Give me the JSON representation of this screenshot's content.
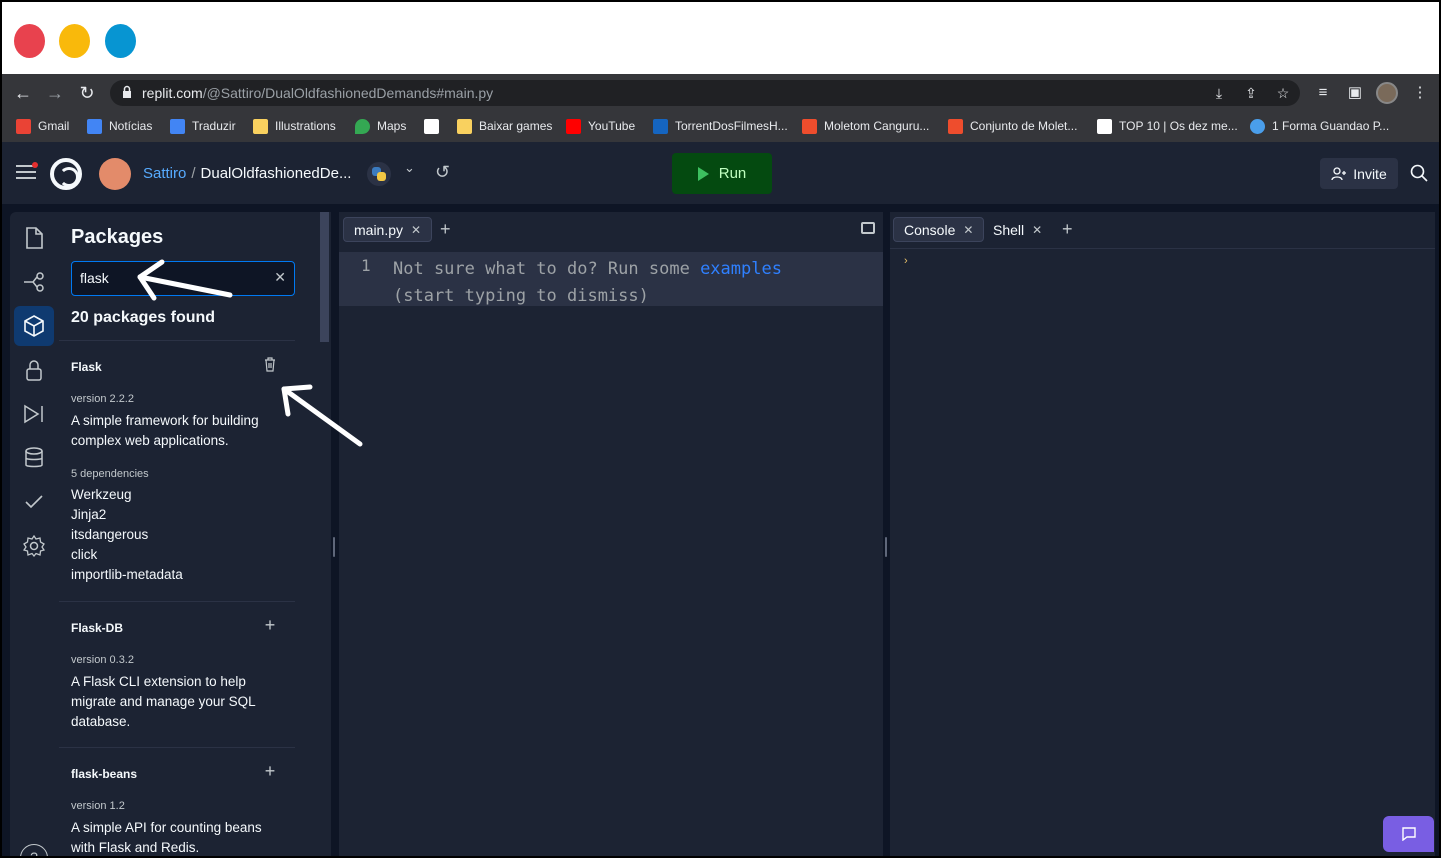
{
  "browser": {
    "url_host": "replit.com",
    "url_path": "/@Sattiro/DualOldfashionedDemands#main.py",
    "bookmarks": [
      {
        "label": "Gmail",
        "color": "#ea4335"
      },
      {
        "label": "Notícias",
        "color": "#4285f4"
      },
      {
        "label": "Traduzir",
        "color": "#4285f4"
      },
      {
        "label": "Illustrations",
        "color": "#f9d15f"
      },
      {
        "label": "Maps",
        "color": "#34a853"
      },
      {
        "label": "",
        "color": "#ffffff"
      },
      {
        "label": "Baixar games",
        "color": "#f9d15f"
      },
      {
        "label": "YouTube",
        "color": "#ff0000"
      },
      {
        "label": "TorrentDosFilmesH...",
        "color": "#1565c0"
      },
      {
        "label": "Moletom Canguru...",
        "color": "#ee4d2d"
      },
      {
        "label": "Conjunto de Molet...",
        "color": "#ee4d2d"
      },
      {
        "label": "TOP 10 | Os dez me...",
        "color": "#ffffff"
      },
      {
        "label": "1 Forma Guandao P...",
        "color": "#4a9eea"
      }
    ]
  },
  "header": {
    "username": "Sattiro",
    "separator": "/",
    "repl_name": "DualOldfashionedDe...",
    "run_label": "Run",
    "invite_label": "Invite"
  },
  "packages": {
    "title": "Packages",
    "search_value": "flask",
    "found_text": "20 packages found",
    "deps_label": "5 dependencies",
    "list": [
      {
        "name": "Flask",
        "version": "version 2.2.2",
        "description": "A simple framework for building complex web applications.",
        "installed": true,
        "dependencies": [
          "Werkzeug",
          "Jinja2",
          "itsdangerous",
          "click",
          "importlib-metadata"
        ]
      },
      {
        "name": "Flask-DB",
        "version": "version 0.3.2",
        "description": "A Flask CLI extension to help migrate and manage your SQL database.",
        "installed": false
      },
      {
        "name": "flask-beans",
        "version": "version 1.2",
        "description": "A simple API for counting beans with Flask and Redis.",
        "installed": false
      }
    ]
  },
  "editor": {
    "tab_label": "main.py",
    "line_number": "1",
    "hint_prefix": "Not sure what to do? Run some",
    "hint_link": "examples",
    "hint_line2": "(start typing to dismiss)"
  },
  "console": {
    "tabs": [
      "Console",
      "Shell"
    ],
    "prompt": "›"
  },
  "colors": {
    "accent": "#0079f2",
    "run_bg": "#044a10",
    "panel_bg": "#1c2333",
    "page_bg": "#0e1525",
    "feedback": "#795ee3"
  }
}
